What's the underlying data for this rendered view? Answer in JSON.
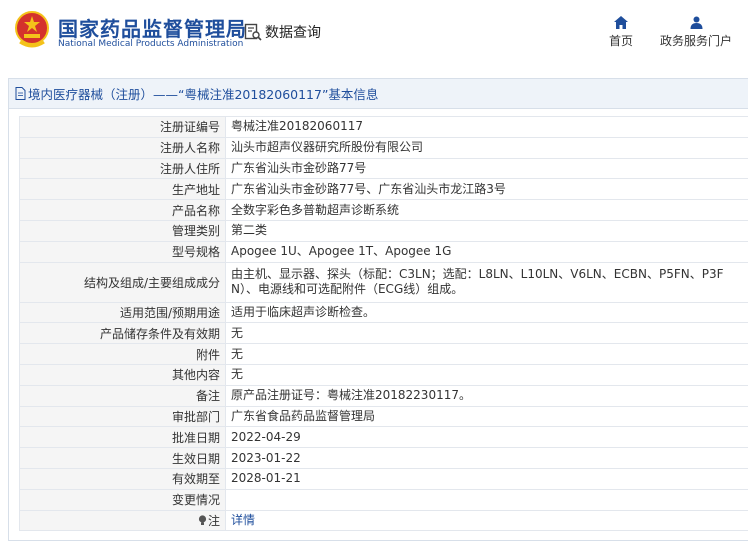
{
  "header": {
    "site_name_cn": "国家药品监督管理局",
    "site_name_en": "National Medical Products Administration",
    "query_label": "数据查询",
    "nav": {
      "home": "首页",
      "gov": "政务服务门户"
    }
  },
  "panel": {
    "title": "境内医疗器械（注册）——“粤械注准20182060117”基本信息"
  },
  "rows": [
    {
      "key": "注册证编号",
      "value": "粤械注准20182060117"
    },
    {
      "key": "注册人名称",
      "value": "汕头市超声仪器研究所股份有限公司"
    },
    {
      "key": "注册人住所",
      "value": "广东省汕头市金砂路77号"
    },
    {
      "key": "生产地址",
      "value": "广东省汕头市金砂路77号、广东省汕头市龙江路3号"
    },
    {
      "key": "产品名称",
      "value": "全数字彩色多普勒超声诊断系统"
    },
    {
      "key": "管理类别",
      "value": "第二类"
    },
    {
      "key": "型号规格",
      "value": "Apogee 1U、Apogee 1T、Apogee 1G"
    },
    {
      "key": "结构及组成/主要组成成分",
      "value_line1": "由主机、显示器、探头（标配：C3LN；选配：L8LN、L10LN、V6LN、ECBN、P5FN、P3F",
      "value_line2": "N）、电源线和可选配附件（ECG线）组成。"
    },
    {
      "key": "适用范围/预期用途",
      "value": "适用于临床超声诊断检查。"
    },
    {
      "key": "产品储存条件及有效期",
      "value": "无"
    },
    {
      "key": "附件",
      "value": "无"
    },
    {
      "key": "其他内容",
      "value": "无"
    },
    {
      "key": "备注",
      "value": "原产品注册证号：粤械注准20182230117。"
    },
    {
      "key": "审批部门",
      "value": "广东省食品药品监督管理局"
    },
    {
      "key": "批准日期",
      "value": "2022-04-29"
    },
    {
      "key": "生效日期",
      "value": "2023-01-22"
    },
    {
      "key": "有效期至",
      "value": "2028-01-21"
    },
    {
      "key": "变更情况",
      "value": ""
    },
    {
      "key": "注",
      "value": "详情"
    }
  ],
  "colors": {
    "brand_blue": "#1f4e9c",
    "emblem_red": "#d4322c",
    "emblem_gold": "#f4c21a"
  }
}
